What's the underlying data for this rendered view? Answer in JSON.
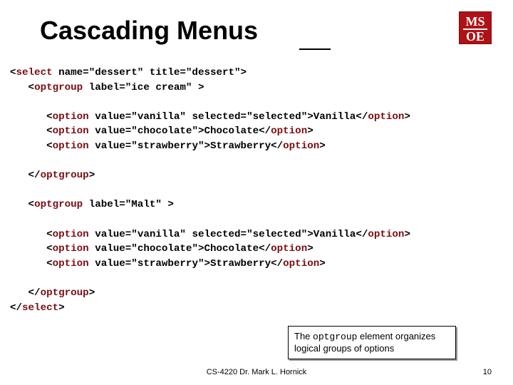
{
  "title": "Cascading Menus",
  "logo": {
    "line1": "MS",
    "line2": "OE"
  },
  "code": {
    "l1a": "<",
    "l1b": "select",
    "l1c": " name=\"dessert\" title=\"dessert\">",
    "l2a": "   <",
    "l2b": "optgroup",
    "l2c": " label=\"ice cream\" >",
    "l3": "",
    "l4a": "      <",
    "l4b": "option",
    "l4c": " value=\"vanilla\" selected=\"selected\">Vanilla</",
    "l4d": "option",
    "l4e": ">",
    "l5a": "      <",
    "l5b": "option",
    "l5c": " value=\"chocolate\">Chocolate</",
    "l5d": "option",
    "l5e": ">",
    "l6a": "      <",
    "l6b": "option",
    "l6c": " value=\"strawberry\">Strawberry</",
    "l6d": "option",
    "l6e": ">",
    "l7": "",
    "l8a": "   </",
    "l8b": "optgroup",
    "l8c": ">",
    "l9": "",
    "l10a": "   <",
    "l10b": "optgroup",
    "l10c": " label=\"Malt\" >",
    "l11": "",
    "l12a": "      <",
    "l12b": "option",
    "l12c": " value=\"vanilla\" selected=\"selected\">Vanilla</",
    "l12d": "option",
    "l12e": ">",
    "l13a": "      <",
    "l13b": "option",
    "l13c": " value=\"chocolate\">Chocolate</",
    "l13d": "option",
    "l13e": ">",
    "l14a": "      <",
    "l14b": "option",
    "l14c": " value=\"strawberry\">Strawberry</",
    "l14d": "option",
    "l14e": ">",
    "l15": "",
    "l16a": "   </",
    "l16b": "optgroup",
    "l16c": ">",
    "l17a": "</",
    "l17b": "select",
    "l17c": ">"
  },
  "callout": {
    "pre": "The ",
    "kw": "optgroup",
    "post": " element organizes logical groups of options"
  },
  "footer": {
    "center": "CS-4220 Dr. Mark L. Hornick",
    "right": "10"
  }
}
